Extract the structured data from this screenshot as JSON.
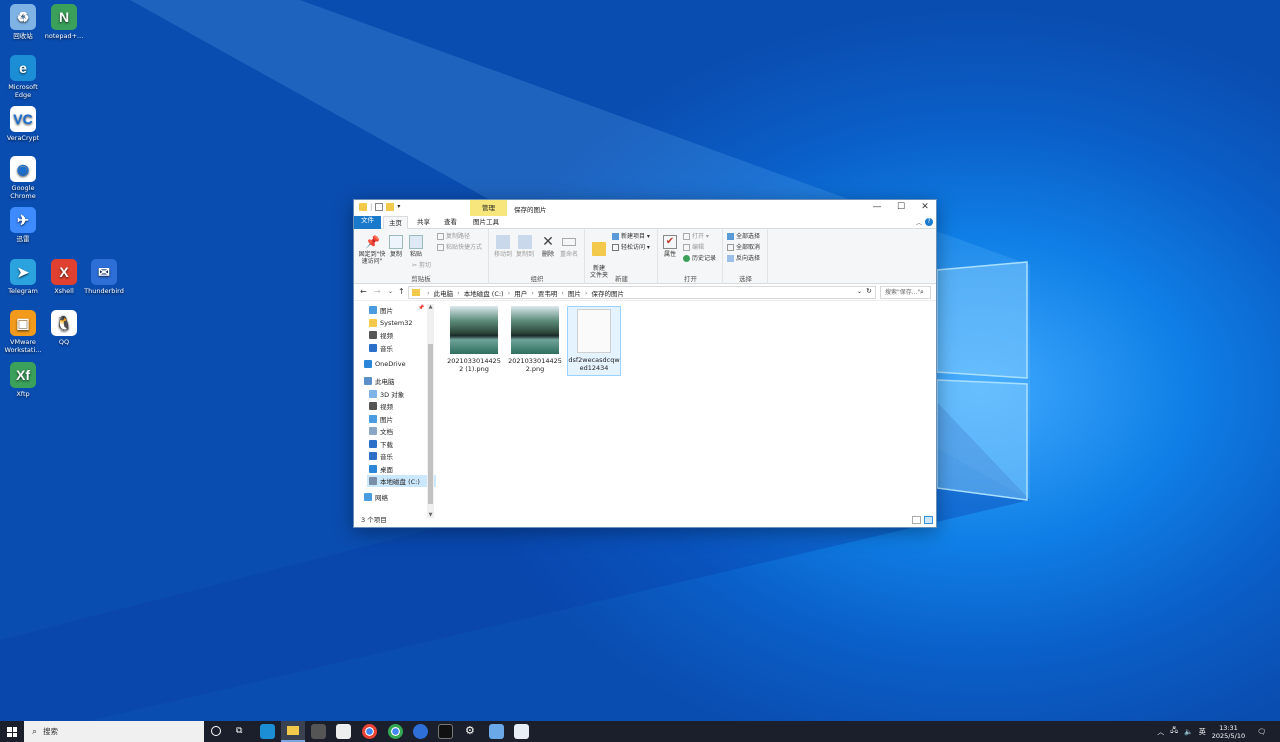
{
  "desktop": {
    "icons": [
      {
        "label": "回收站",
        "color": "#7fb3e6",
        "glyph": "♻"
      },
      {
        "label": "notepad+...",
        "color": "#3aa05a",
        "glyph": "N"
      },
      {
        "label": "Microsoft Edge",
        "color": "#1b8ed6",
        "glyph": "e"
      },
      {
        "label": "VeraCrypt",
        "color": "#ffffff",
        "glyph": "VC"
      },
      {
        "label": "Google Chrome",
        "color": "#ffffff",
        "glyph": "◉"
      },
      {
        "label": "迅雷",
        "color": "#3d8bff",
        "glyph": "✈"
      },
      {
        "label": "Telegram",
        "color": "#2aa3df",
        "glyph": "➤"
      },
      {
        "label": "Xshell",
        "color": "#e0402f",
        "glyph": "X"
      },
      {
        "label": "Thunderbird",
        "color": "#2d6fd6",
        "glyph": "✉"
      },
      {
        "label": "VMware Workstati...",
        "color": "#f29a1b",
        "glyph": "▣"
      },
      {
        "label": "QQ",
        "color": "#ffffff",
        "glyph": "🐧"
      },
      {
        "label": "Xftp",
        "color": "#3aa05a",
        "glyph": "Xf"
      }
    ]
  },
  "window": {
    "quick_access_sep": "|",
    "context_tab": "管理",
    "title": "保存的图片",
    "controls": {
      "minimize": "—",
      "maximize": "☐",
      "close": "✕"
    },
    "tabs": [
      "文件",
      "主页",
      "共享",
      "查看",
      "图片工具"
    ],
    "ribbon": {
      "clipboard": {
        "pin": "固定到\"快速访问\"",
        "copy": "复制",
        "paste": "粘贴",
        "copy_path": "复制路径",
        "paste_shortcut": "粘贴快捷方式",
        "cut": "剪切",
        "label": "剪贴板"
      },
      "organize": {
        "move_to": "移动到",
        "copy_to": "复制到",
        "delete": "删除",
        "rename": "重命名",
        "label": "组织"
      },
      "new": {
        "new_item": "新建项目 ▾",
        "easy_access": "轻松访问 ▾",
        "new_folder": "新建\n文件夹",
        "label": "新建"
      },
      "open": {
        "properties": "属性",
        "open": "打开 ▾",
        "edit": "编辑",
        "history": "历史记录",
        "label": "打开"
      },
      "select": {
        "select_all": "全部选择",
        "select_none": "全部取消",
        "invert": "反向选择",
        "label": "选择"
      }
    },
    "address": {
      "crumbs": [
        "此电脑",
        "本地磁盘 (C:)",
        "用户",
        "贾韦明",
        "图片",
        "保存的图片"
      ],
      "separator": "›",
      "search_placeholder": "搜索\"保存...\""
    },
    "nav": {
      "quick": [
        "图片",
        "System32",
        "视频",
        "音乐"
      ],
      "onedrive": "OneDrive",
      "thispc": "此电脑",
      "pc_items": [
        "3D 对象",
        "视频",
        "图片",
        "文档",
        "下载",
        "音乐",
        "桌面",
        "本地磁盘 (C:)"
      ],
      "network": "网络"
    },
    "files": [
      {
        "name": "2021033014425\n2 (1).png",
        "type": "image"
      },
      {
        "name": "2021033014425\n2.png",
        "type": "image"
      },
      {
        "name": "dsf2wecasdcqw\ned12434",
        "type": "blank"
      }
    ],
    "status": "3 个项目"
  },
  "taskbar": {
    "search_placeholder": "搜索",
    "tray_lang": "英",
    "time": "13:31",
    "date": "2025/5/10"
  }
}
